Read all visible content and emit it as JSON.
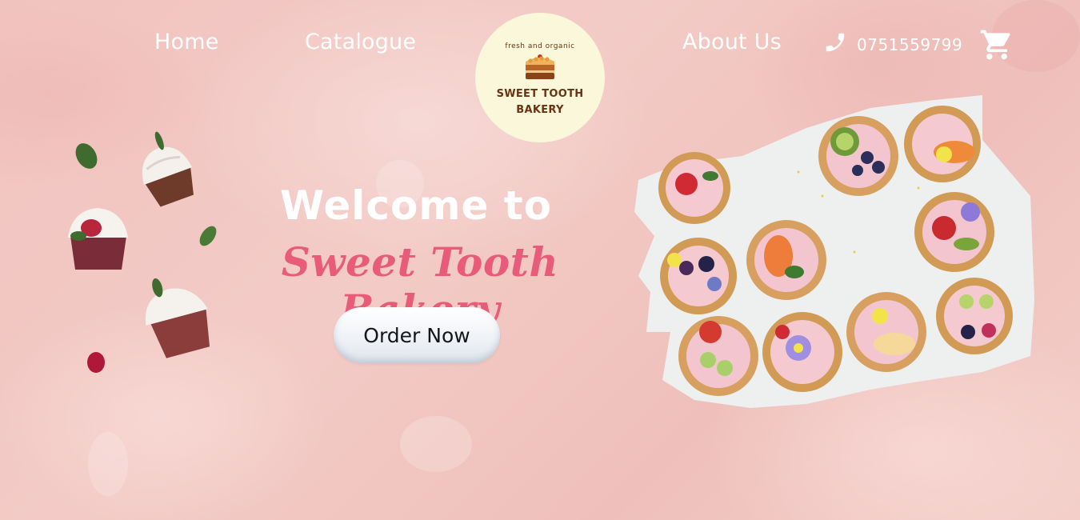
{
  "nav": {
    "home": "Home",
    "catalogue": "Catalogue",
    "about": "About Us",
    "phone": "0751559799"
  },
  "logo": {
    "tagline": "fresh and organic",
    "name_line1": "SWEET TOOTH",
    "name_line2": "BAKERY"
  },
  "hero": {
    "welcome": "Welcome to",
    "brand": "Sweet Tooth Bakery",
    "cta": "Order Now"
  },
  "icons": {
    "phone": "phone-icon",
    "cart": "cart-icon"
  },
  "colors": {
    "background": "#f1c3bf",
    "brand_script": "#e95b7a",
    "logo_bg": "#fbf7da",
    "logo_text": "#6b3212",
    "nav_text": "#ffffff"
  }
}
